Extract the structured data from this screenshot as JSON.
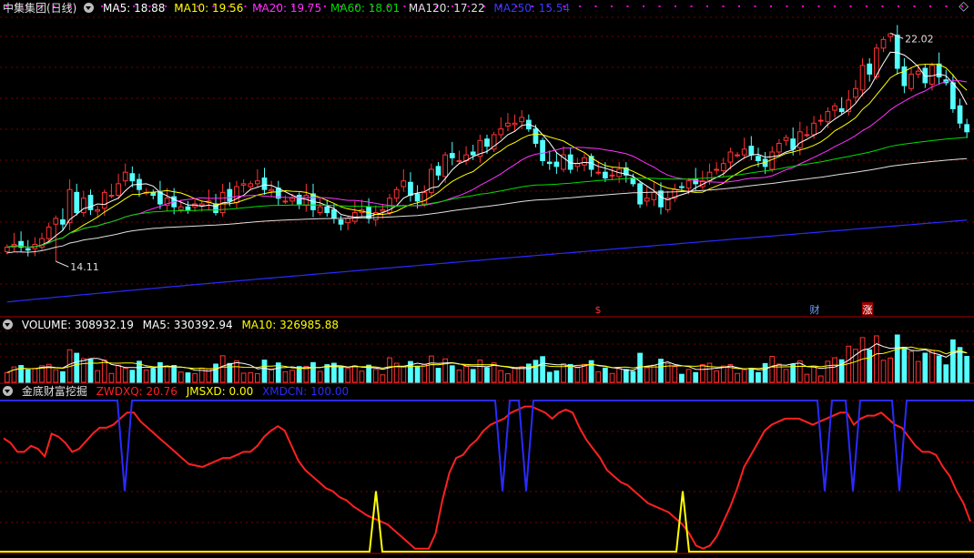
{
  "colors": {
    "bg": "#000000",
    "up": "#ff3232",
    "down": "#54ffff",
    "grid": "#7a0000",
    "sep": "#b00000",
    "ma5": "#ffffff",
    "ma10": "#ffff00",
    "ma20": "#ff33ff",
    "ma60": "#00dd00",
    "ma120": "#e0e0e0",
    "ma250": "#2a2aff",
    "dot": "#ff00ff"
  },
  "price_panel": {
    "title": "中集集团(日线)",
    "legend": [
      {
        "label": "MA5: 18.88",
        "color": "#ffffff"
      },
      {
        "label": "MA10: 19.56",
        "color": "#ffff00"
      },
      {
        "label": "MA20: 19.75",
        "color": "#ff33ff"
      },
      {
        "label": "MA60: 18.01",
        "color": "#00dd00"
      },
      {
        "label": "MA120: 17.22",
        "color": "#e0e0e0"
      },
      {
        "label": "MA250: 15.54",
        "color": "#3a3aff"
      }
    ],
    "high_label": "22.02",
    "low_label": "14.11",
    "markers": [
      {
        "text": "$",
        "color": "#ff3232"
      },
      {
        "text": "财",
        "color": "#6aa0ff"
      },
      {
        "text": "涨",
        "color": "#ffffff"
      }
    ]
  },
  "volume_panel": {
    "legend": [
      {
        "label": "VOLUME: 308932.19",
        "color": "#ffffff"
      },
      {
        "label": "MA5: 330392.94",
        "color": "#ffffff"
      },
      {
        "label": "MA10: 326985.88",
        "color": "#ffff00"
      }
    ]
  },
  "indicator_panel": {
    "title": "金底财富挖掘",
    "legend": [
      {
        "label": "ZWDXQ: 20.76",
        "color": "#ff2020"
      },
      {
        "label": "JMSXD: 0.00",
        "color": "#ffff00"
      },
      {
        "label": "XMDCN: 100.00",
        "color": "#2a2aff"
      }
    ]
  },
  "chart_data": {
    "type": "candlestick",
    "title": "中集集团(日线)",
    "price_range": [
      12.6,
      22.6
    ],
    "high": 22.02,
    "low": 14.11,
    "ma_last": {
      "MA5": 18.88,
      "MA10": 19.56,
      "MA20": 19.75,
      "MA60": 18.01,
      "MA120": 17.22,
      "MA250": 15.54
    },
    "closes": [
      14.6,
      14.7,
      14.6,
      14.5,
      14.7,
      14.9,
      15.3,
      15.6,
      15.4,
      16.6,
      15.8,
      16.3,
      15.9,
      15.9,
      16.5,
      16.4,
      16.8,
      17.2,
      16.9,
      16.6,
      16.5,
      16.4,
      16.1,
      16.3,
      16.0,
      16.0,
      15.9,
      16.1,
      16.1,
      16.2,
      15.8,
      16.5,
      16.2,
      16.7,
      16.8,
      16.8,
      16.9,
      16.6,
      16.6,
      16.3,
      16.2,
      16.3,
      16.1,
      16.4,
      15.9,
      16.0,
      15.8,
      15.6,
      15.4,
      15.6,
      15.8,
      15.9,
      15.6,
      15.8,
      15.9,
      16.3,
      16.6,
      16.9,
      16.4,
      16.2,
      16.5,
      17.3,
      17.1,
      17.8,
      17.7,
      17.6,
      17.8,
      17.8,
      18.3,
      18.1,
      18.5,
      18.7,
      18.9,
      18.9,
      19.1,
      18.7,
      18.2,
      17.6,
      17.5,
      17.4,
      17.8,
      17.3,
      17.5,
      17.7,
      17.3,
      17.2,
      17.0,
      17.1,
      17.3,
      17.1,
      16.8,
      16.1,
      16.3,
      16.5,
      16.0,
      16.3,
      16.6,
      16.7,
      16.9,
      16.8,
      16.9,
      17.2,
      17.3,
      17.5,
      17.9,
      17.8,
      18.0,
      17.8,
      17.6,
      17.4,
      17.9,
      18.2,
      18.4,
      18.0,
      18.6,
      18.5,
      18.9,
      19.0,
      19.3,
      19.5,
      19.3,
      19.7,
      20.1,
      20.9,
      20.6,
      21.5,
      21.8,
      22.0,
      20.8,
      20.2,
      20.6,
      20.7,
      20.3,
      20.9,
      20.5,
      20.3,
      19.4,
      18.9,
      18.6
    ],
    "volume": {
      "last": 308932.19,
      "MA5": 330392.94,
      "MA10": 326985.88
    },
    "indicator": {
      "ZWDXQ_last": 20.76,
      "JMSXD_last": 0.0,
      "XMDCN_last": 100.0,
      "ZWDXQ": [
        75,
        72,
        66,
        66,
        70,
        68,
        63,
        78,
        76,
        72,
        66,
        68,
        73,
        78,
        82,
        82,
        84,
        88,
        92,
        92,
        86,
        82,
        78,
        74,
        70,
        66,
        62,
        58,
        57,
        56,
        58,
        60,
        62,
        62,
        64,
        66,
        66,
        70,
        76,
        80,
        83,
        80,
        70,
        60,
        54,
        50,
        46,
        42,
        40,
        36,
        34,
        30,
        27,
        24,
        22,
        20,
        18,
        14,
        10,
        6,
        2,
        2,
        2,
        12,
        34,
        52,
        62,
        64,
        70,
        74,
        80,
        84,
        86,
        88,
        92,
        94,
        96,
        96,
        94,
        92,
        88,
        92,
        94,
        92,
        82,
        74,
        68,
        62,
        54,
        50,
        46,
        44,
        40,
        36,
        32,
        30,
        28,
        26,
        22,
        18,
        12,
        4,
        2,
        4,
        10,
        20,
        30,
        42,
        56,
        64,
        72,
        80,
        84,
        86,
        88,
        88,
        88,
        86,
        84,
        86,
        88,
        90,
        92,
        92,
        84,
        88,
        90,
        90,
        92,
        88,
        84,
        82,
        76,
        70,
        66,
        66,
        64,
        56,
        50,
        40,
        32,
        20
      ]
    }
  }
}
